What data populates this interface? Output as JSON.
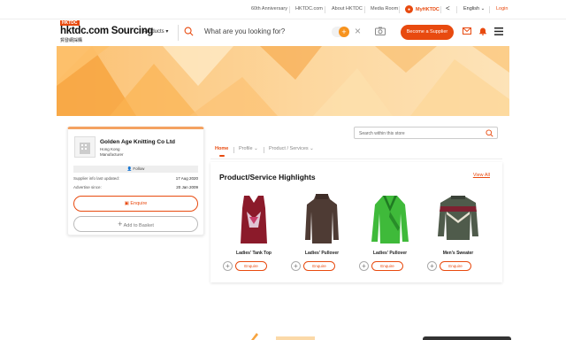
{
  "topbar": {
    "links": [
      "60th Anniversary",
      "HKTDC.com",
      "About HKTDC",
      "Media Room"
    ],
    "my_hktdc": "MyHKTDC",
    "language": "English",
    "login": "Login"
  },
  "header": {
    "logo_tag": "HKTDC",
    "logo_title": "hktdc.com Sourcing",
    "logo_subtitle": "貿發網採購",
    "products_label": "Products",
    "search_placeholder": "What are you looking for?",
    "become_supplier": "Become a Supplier",
    "icons": [
      "search-icon",
      "plus-icon",
      "close-icon",
      "camera-icon",
      "mail-icon",
      "bell-icon",
      "menu-icon"
    ]
  },
  "supplier": {
    "name": "Golden Age Knitting Co Ltd",
    "location": "Hong Kong",
    "type": "Manufacturer",
    "follow": "Follow",
    "info_updated_label": "Supplier info last updated:",
    "info_updated_value": "17 Aug 2020",
    "advertise_label": "Advertise since:",
    "advertise_value": "20 Jan 2009",
    "enquire": "Enquire",
    "add_to_basket": "Add to Basket"
  },
  "store": {
    "search_placeholder": "Search within this store",
    "tabs": [
      "Home",
      "Profile",
      "Product / Services"
    ]
  },
  "highlights": {
    "title": "Product/Service Highlights",
    "view_all": "View All",
    "enquire": "Enquire",
    "products": [
      {
        "name": "Ladies' Tank Top"
      },
      {
        "name": "Ladies' Pullover"
      },
      {
        "name": "Ladies' Pullover"
      },
      {
        "name": "Men's Sweater"
      }
    ]
  },
  "colors": {
    "accent": "#e84a0f",
    "banner": "#fcc67c"
  }
}
